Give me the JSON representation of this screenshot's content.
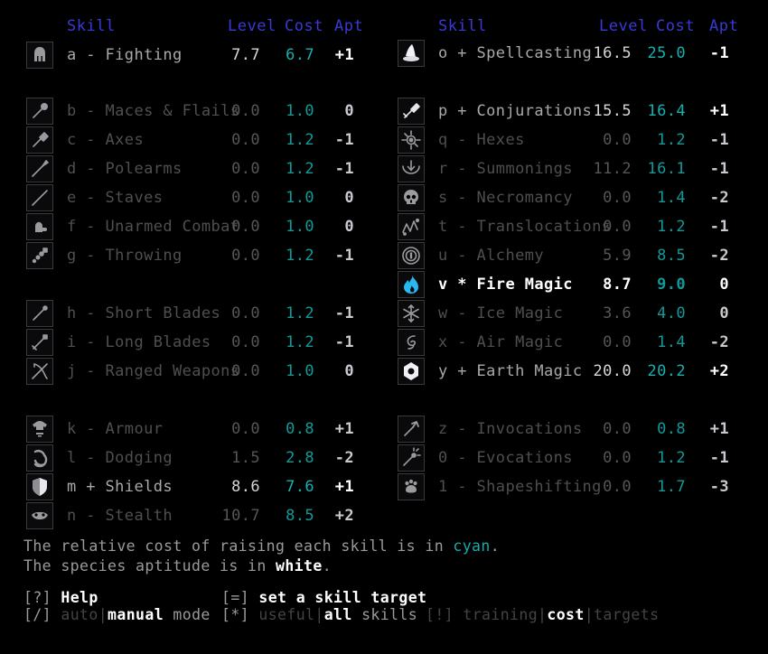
{
  "headers": {
    "skill": "Skill",
    "level": "Level",
    "cost": "Cost",
    "apt": "Apt"
  },
  "colors": {
    "header": "#3939d6",
    "cost": "#119a9a",
    "dim": "#4f4f52",
    "bright": "#a9a9ad",
    "focus": "#ffffff"
  },
  "left_column": {
    "groups": [
      {
        "rows": [
          {
            "key": "a",
            "mark": "-",
            "name": "Fighting",
            "level": "7.7",
            "cost": "6.7",
            "apt": "+1",
            "state": "bright",
            "icon": "helmet-icon"
          }
        ]
      },
      {
        "rows": [
          {
            "key": "b",
            "mark": "-",
            "name": "Maces & Flails",
            "level": "0.0",
            "cost": "1.0",
            "apt": "0",
            "state": "dim",
            "icon": "mace-icon"
          },
          {
            "key": "c",
            "mark": "-",
            "name": "Axes",
            "level": "0.0",
            "cost": "1.2",
            "apt": "-1",
            "state": "dim",
            "icon": "axe-icon"
          },
          {
            "key": "d",
            "mark": "-",
            "name": "Polearms",
            "level": "0.0",
            "cost": "1.2",
            "apt": "-1",
            "state": "dim",
            "icon": "polearm-icon"
          },
          {
            "key": "e",
            "mark": "-",
            "name": "Staves",
            "level": "0.0",
            "cost": "1.0",
            "apt": "0",
            "state": "dim",
            "icon": "staff-icon"
          },
          {
            "key": "f",
            "mark": "-",
            "name": "Unarmed Combat",
            "level": "0.0",
            "cost": "1.0",
            "apt": "0",
            "state": "dim",
            "icon": "fist-icon"
          },
          {
            "key": "g",
            "mark": "-",
            "name": "Throwing",
            "level": "0.0",
            "cost": "1.2",
            "apt": "-1",
            "state": "dim",
            "icon": "throwing-icon"
          }
        ]
      },
      {
        "rows": [
          {
            "key": "h",
            "mark": "-",
            "name": "Short Blades",
            "level": "0.0",
            "cost": "1.2",
            "apt": "-1",
            "state": "dim",
            "icon": "dagger-icon"
          },
          {
            "key": "i",
            "mark": "-",
            "name": "Long Blades",
            "level": "0.0",
            "cost": "1.2",
            "apt": "-1",
            "state": "dim",
            "icon": "sword-icon"
          },
          {
            "key": "j",
            "mark": "-",
            "name": "Ranged Weapons",
            "level": "0.0",
            "cost": "1.0",
            "apt": "0",
            "state": "dim",
            "icon": "bow-icon"
          }
        ]
      },
      {
        "rows": [
          {
            "key": "k",
            "mark": "-",
            "name": "Armour",
            "level": "0.0",
            "cost": "0.8",
            "apt": "+1",
            "state": "dim",
            "icon": "armour-icon"
          },
          {
            "key": "l",
            "mark": "-",
            "name": "Dodging",
            "level": "1.5",
            "cost": "2.8",
            "apt": "-2",
            "state": "dim",
            "icon": "dodge-icon"
          },
          {
            "key": "m",
            "mark": "+",
            "name": "Shields",
            "level": "8.6",
            "cost": "7.6",
            "apt": "+1",
            "state": "bright",
            "icon": "shield-icon"
          },
          {
            "key": "n",
            "mark": "-",
            "name": "Stealth",
            "level": "10.7",
            "cost": "8.5",
            "apt": "+2",
            "state": "dim",
            "icon": "stealth-icon"
          }
        ]
      }
    ]
  },
  "right_column": {
    "groups": [
      {
        "rows": [
          {
            "key": "o",
            "mark": "+",
            "name": "Spellcasting",
            "level": "16.5",
            "cost": "25.0",
            "apt": "-1",
            "state": "bright",
            "icon": "wizard-hat-icon"
          }
        ]
      },
      {
        "rows": [
          {
            "key": "p",
            "mark": "+",
            "name": "Conjurations",
            "level": "15.5",
            "cost": "16.4",
            "apt": "+1",
            "state": "bright",
            "icon": "conjuration-icon"
          },
          {
            "key": "q",
            "mark": "-",
            "name": "Hexes",
            "level": "0.0",
            "cost": "1.2",
            "apt": "-1",
            "state": "dim",
            "icon": "hex-icon"
          },
          {
            "key": "r",
            "mark": "-",
            "name": "Summonings",
            "level": "11.2",
            "cost": "16.1",
            "apt": "-1",
            "state": "dim",
            "icon": "summoning-icon"
          },
          {
            "key": "s",
            "mark": "-",
            "name": "Necromancy",
            "level": "0.0",
            "cost": "1.4",
            "apt": "-2",
            "state": "dim",
            "icon": "skull-icon"
          },
          {
            "key": "t",
            "mark": "-",
            "name": "Translocations",
            "level": "0.0",
            "cost": "1.2",
            "apt": "-1",
            "state": "dim",
            "icon": "translocation-icon"
          },
          {
            "key": "u",
            "mark": "-",
            "name": "Alchemy",
            "level": "5.9",
            "cost": "8.5",
            "apt": "-2",
            "state": "dim",
            "icon": "alchemy-icon"
          },
          {
            "key": "v",
            "mark": "*",
            "name": "Fire Magic",
            "level": "8.7",
            "cost": "9.0",
            "apt": "0",
            "state": "focus",
            "icon": "fire-icon"
          },
          {
            "key": "w",
            "mark": "-",
            "name": "Ice Magic",
            "level": "3.6",
            "cost": "4.0",
            "apt": "0",
            "state": "dim",
            "icon": "ice-icon"
          },
          {
            "key": "x",
            "mark": "-",
            "name": "Air Magic",
            "level": "0.0",
            "cost": "1.4",
            "apt": "-2",
            "state": "dim",
            "icon": "air-icon"
          },
          {
            "key": "y",
            "mark": "+",
            "name": "Earth Magic",
            "level": "20.0",
            "cost": "20.2",
            "apt": "+2",
            "state": "bright",
            "icon": "earth-icon"
          }
        ]
      },
      {
        "rows": [
          {
            "key": "z",
            "mark": "-",
            "name": "Invocations",
            "level": "0.0",
            "cost": "0.8",
            "apt": "+1",
            "state": "dim",
            "icon": "invocation-icon"
          },
          {
            "key": "0",
            "mark": "-",
            "name": "Evocations",
            "level": "0.0",
            "cost": "1.2",
            "apt": "-1",
            "state": "dim",
            "icon": "evocation-icon"
          },
          {
            "key": "1",
            "mark": "-",
            "name": "Shapeshifting",
            "level": "0.0",
            "cost": "1.7",
            "apt": "-3",
            "state": "dim",
            "icon": "shapeshift-icon"
          }
        ]
      }
    ]
  },
  "legend": {
    "line1_pre": "The relative cost of raising each skill is in ",
    "line1_kw": "cyan",
    "line1_post": ".",
    "line2_pre": "The species aptitude is in ",
    "line2_kw": "white",
    "line2_post": "."
  },
  "footer": {
    "help_key": "[?]",
    "help_label": "Help",
    "target_key": "[=]",
    "target_label": "set a skill target",
    "mode_key": "[/]",
    "mode_auto": "auto",
    "mode_sep": "|",
    "mode_manual": "manual",
    "mode_suffix": " mode",
    "filter_key": "[*]",
    "filter_useful": "useful",
    "filter_sep": "|",
    "filter_all": "all",
    "filter_suffix": " skills",
    "view_key": "[!]",
    "view_training": "training",
    "view_sep1": "|",
    "view_cost": "cost",
    "view_sep2": "|",
    "view_targets": "targets"
  }
}
